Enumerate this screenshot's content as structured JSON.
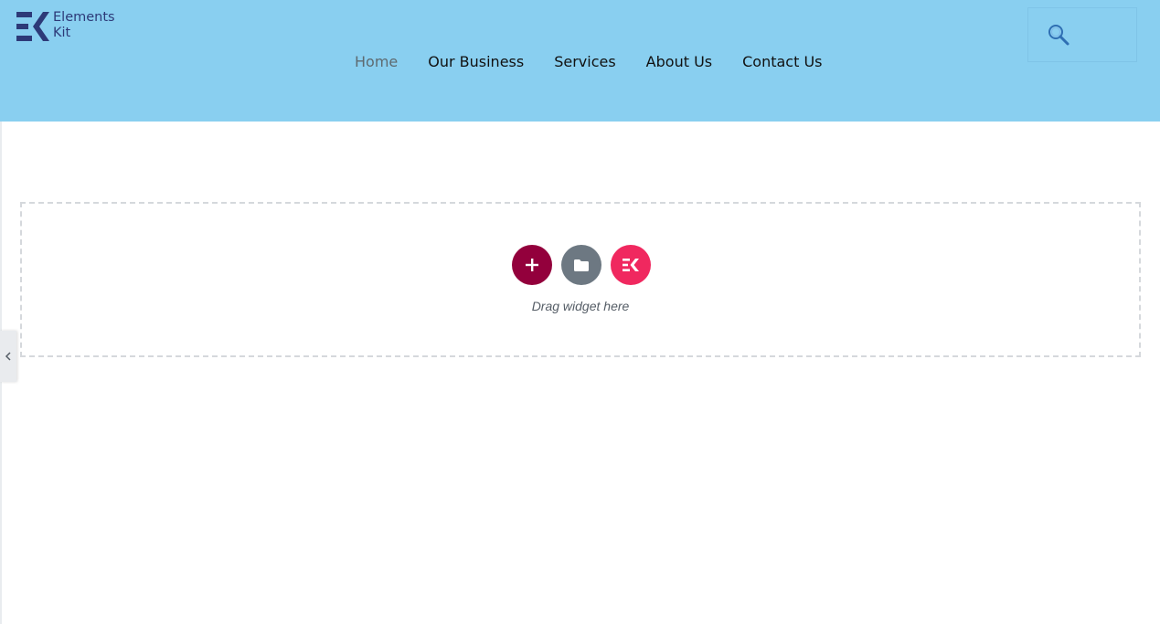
{
  "logo": {
    "line1": "Elements",
    "line2": "Kit",
    "color": "#2d3a78"
  },
  "nav": {
    "items": [
      {
        "label": "Home",
        "active": true
      },
      {
        "label": "Our Business",
        "active": false
      },
      {
        "label": "Services",
        "active": false
      },
      {
        "label": "About Us",
        "active": false
      },
      {
        "label": "Contact Us",
        "active": false
      }
    ]
  },
  "header": {
    "background": "#89cff0"
  },
  "search": {
    "icon": "search-icon"
  },
  "dropzone": {
    "hint": "Drag widget here",
    "buttons": [
      {
        "icon": "plus-icon",
        "color": "#93003c"
      },
      {
        "icon": "folder-icon",
        "color": "#6d7882"
      },
      {
        "icon": "elementskit-icon",
        "color": "#f0285f"
      }
    ]
  },
  "panel_toggle": {
    "icon": "chevron-left-icon"
  }
}
